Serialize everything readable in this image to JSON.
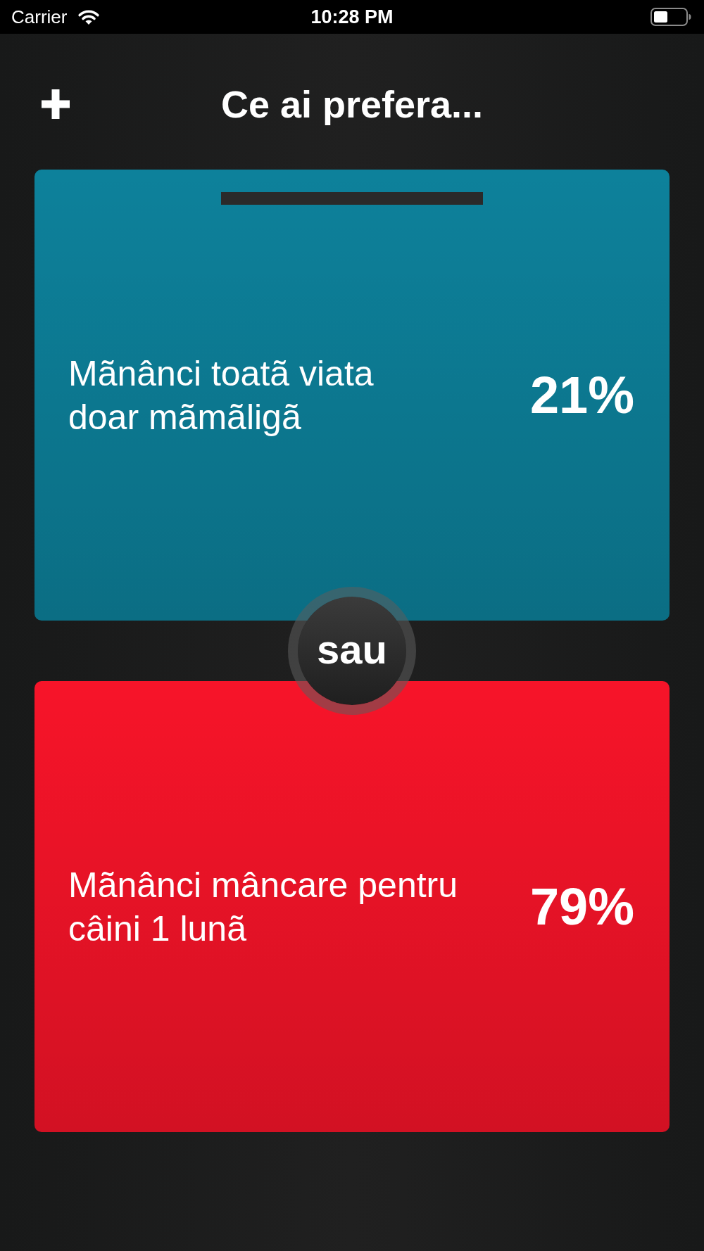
{
  "status_bar": {
    "carrier": "Carrier",
    "time": "10:28 PM"
  },
  "header": {
    "title": "Ce ai prefera..."
  },
  "options": [
    {
      "text": "Mãnânci toatã viata\ndoar mãmãligã",
      "percent": "21%",
      "color": "#0d819b",
      "top_bar": true
    },
    {
      "text": "Mãnânci mâncare pentru\ncâini 1 lunã",
      "percent": "79%",
      "color": "#f71429",
      "top_bar": false
    }
  ],
  "separator": {
    "label": "sau"
  }
}
